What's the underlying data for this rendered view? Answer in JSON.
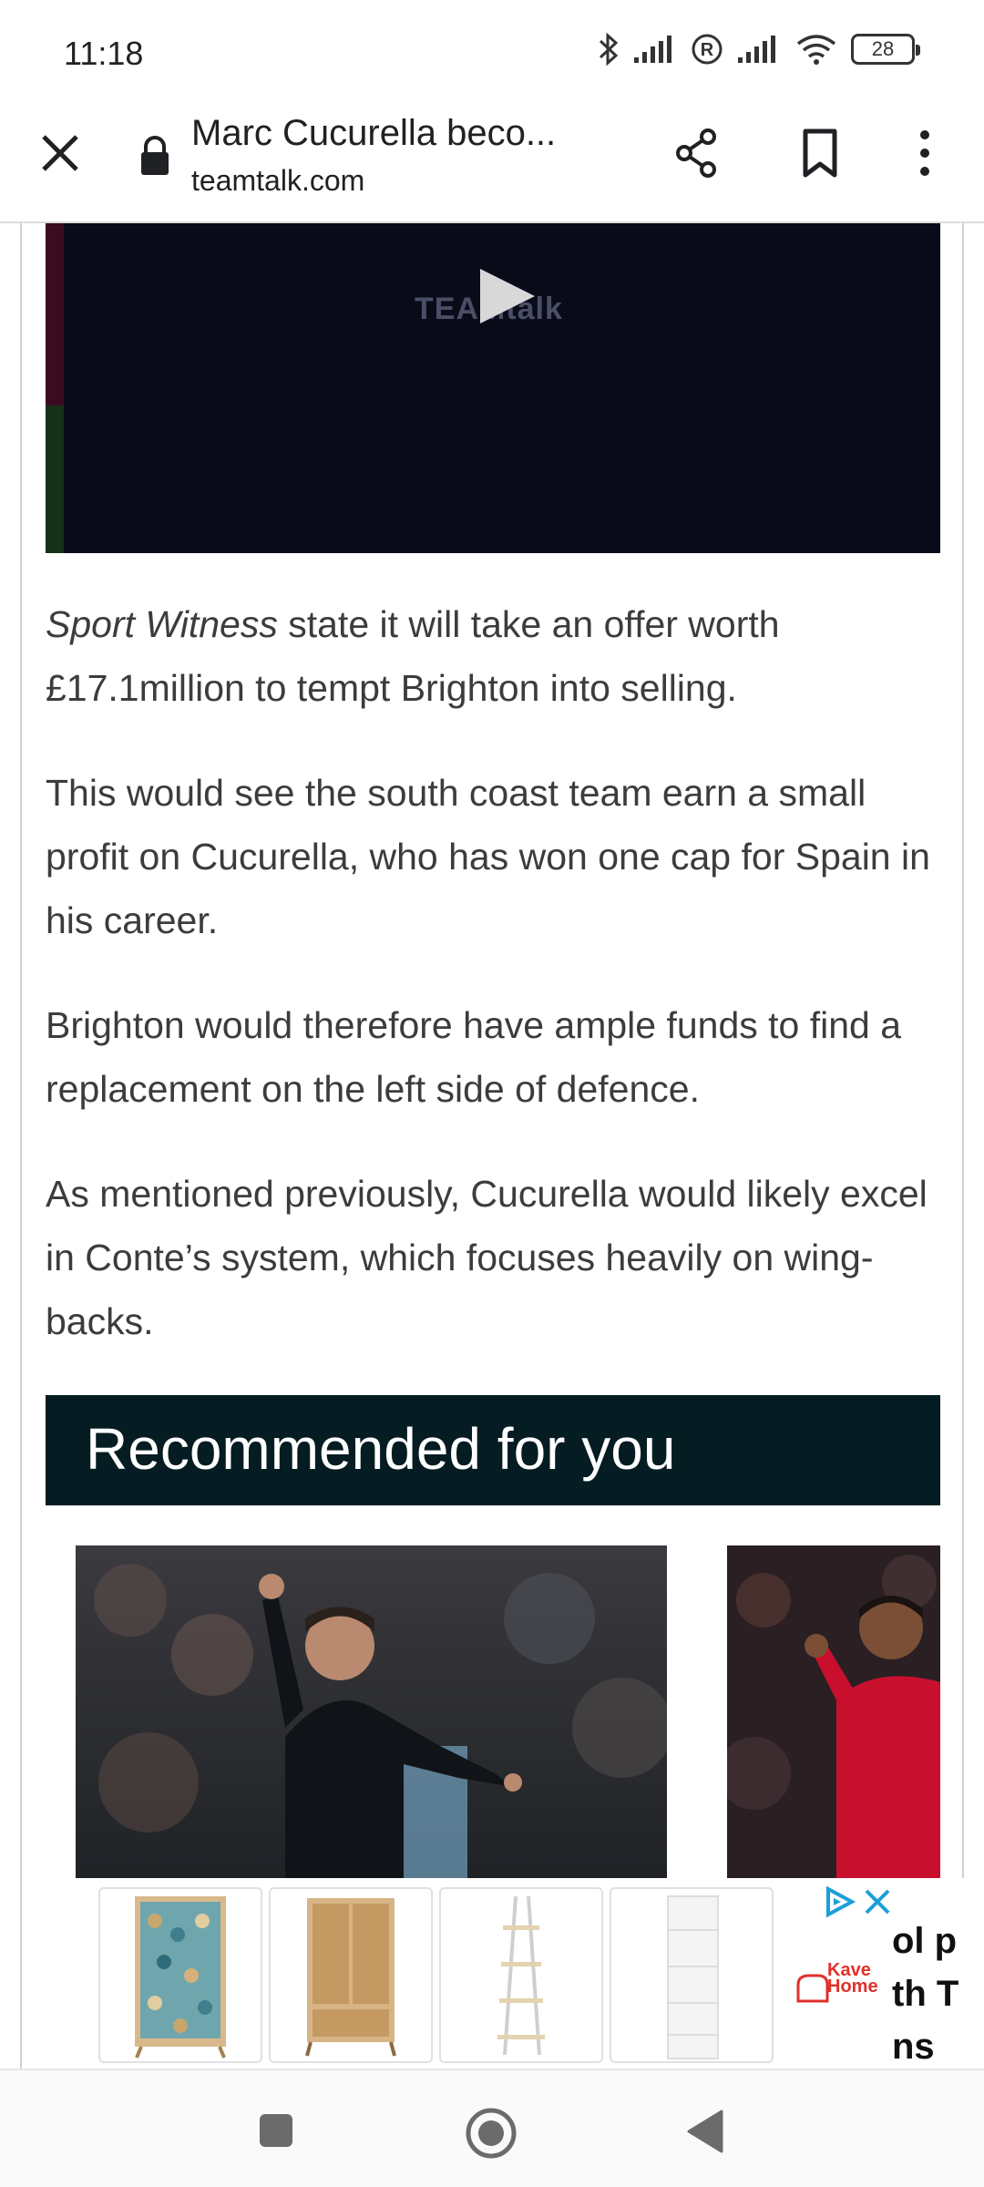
{
  "status_bar": {
    "time": "11:18",
    "battery": "28",
    "icons": [
      "bluetooth-icon",
      "signal-icon",
      "registered-icon",
      "signal-icon",
      "wifi-icon",
      "battery-icon"
    ]
  },
  "browser": {
    "page_title": "Marc Cucurella beco...",
    "domain": "teamtalk.com",
    "icons": [
      "close-icon",
      "lock-icon",
      "share-icon",
      "bookmark-icon",
      "more-vert-icon"
    ]
  },
  "video": {
    "logo_text": "TEAMtalk",
    "icons": [
      "play-icon"
    ]
  },
  "article": {
    "p1_em": "Sport Witness",
    "p1_rest": " state it will take an offer worth £17.1million to tempt Brighton into selling.",
    "p2": "This would see the south coast team earn a small profit on Cucurella, who has won one cap for Spain in his career.",
    "p3": "Brighton would therefore have ample funds to find a replacement on the left side of defence.",
    "p4": "As mentioned previously, Cucurella would likely excel in Conte’s system, which focuses heavily on wing-backs."
  },
  "recommended": {
    "title": "Recommended for you"
  },
  "ad": {
    "brand_line1": "Kave",
    "brand_line2": "Home",
    "cut_line1": "ol p",
    "cut_line2": "th T",
    "cut_line3": "ns",
    "icons": [
      "adchoices-icon",
      "close-icon"
    ]
  },
  "nav": {
    "icons": [
      "recent-apps-icon",
      "home-icon",
      "back-icon"
    ]
  },
  "colors": {
    "rec_header_bg": "#041c22",
    "video_bg": "#0a0b19",
    "ad_brand": "#e0312b",
    "adchoice": "#1aa0d8"
  }
}
